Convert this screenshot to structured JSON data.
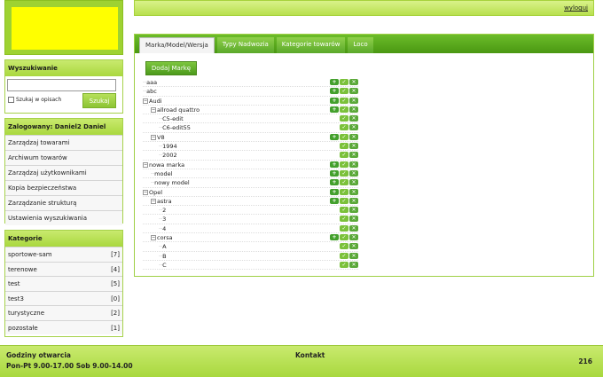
{
  "header": {
    "logout": "wyloguj"
  },
  "search": {
    "title": "Wyszukiwanie",
    "placeholder": "",
    "checkbox_label": "Szukaj w opisach",
    "button": "Szukaj"
  },
  "user": {
    "title": "Zalogowany: Daniel2 Daniel",
    "menu": [
      "Zarządzaj towarami",
      "Archiwum towarów",
      "Zarządzaj użytkownikami",
      "Kopia bezpieczeństwa",
      "Zarządzanie strukturą",
      "Ustawienia wyszukiwania"
    ]
  },
  "categories": {
    "title": "Kategorie",
    "items": [
      {
        "name": "sportowe-sam",
        "count": "[7]"
      },
      {
        "name": "terenowe",
        "count": "[4]"
      },
      {
        "name": "test",
        "count": "[5]"
      },
      {
        "name": "test3",
        "count": "[0]"
      },
      {
        "name": "turystyczne",
        "count": "[2]"
      },
      {
        "name": "pozostałe",
        "count": "[1]"
      }
    ]
  },
  "tabs": [
    "Marka/Model/Wersja",
    "Typy Nadwozia",
    "Kategorie towarów",
    "Loco"
  ],
  "add_button": "Dodaj Markę",
  "tree": [
    {
      "label": "aaa",
      "level": 0,
      "exp": false,
      "add": true
    },
    {
      "label": "abc",
      "level": 0,
      "exp": false,
      "add": true
    },
    {
      "label": "Audi",
      "level": 0,
      "exp": true,
      "add": true
    },
    {
      "label": "allroad quattro",
      "level": 1,
      "exp": true,
      "add": true
    },
    {
      "label": "C5-edit",
      "level": 2,
      "exp": false,
      "add": false
    },
    {
      "label": "C6-edit55",
      "level": 2,
      "exp": false,
      "add": false
    },
    {
      "label": "V8",
      "level": 1,
      "exp": true,
      "add": true
    },
    {
      "label": "1994",
      "level": 2,
      "exp": false,
      "add": false
    },
    {
      "label": "2002",
      "level": 2,
      "exp": false,
      "add": false
    },
    {
      "label": "nowa marka",
      "level": 0,
      "exp": true,
      "add": true
    },
    {
      "label": "model",
      "level": 1,
      "exp": false,
      "add": true
    },
    {
      "label": "nowy model",
      "level": 1,
      "exp": false,
      "add": true
    },
    {
      "label": "Opel",
      "level": 0,
      "exp": true,
      "add": true
    },
    {
      "label": "astra",
      "level": 1,
      "exp": true,
      "add": true
    },
    {
      "label": "2",
      "level": 2,
      "exp": false,
      "add": false
    },
    {
      "label": "3",
      "level": 2,
      "exp": false,
      "add": false
    },
    {
      "label": "4",
      "level": 2,
      "exp": false,
      "add": false
    },
    {
      "label": "corsa",
      "level": 1,
      "exp": true,
      "add": true
    },
    {
      "label": "A",
      "level": 2,
      "exp": false,
      "add": false
    },
    {
      "label": "B",
      "level": 2,
      "exp": false,
      "add": false
    },
    {
      "label": "C",
      "level": 2,
      "exp": false,
      "add": false
    }
  ],
  "footer": {
    "hours_title": "Godziny otwarcia",
    "hours": "Pon-Pt 9.00-17.00 Sob 9.00-14.00",
    "contact": "Kontakt",
    "count": "216"
  }
}
